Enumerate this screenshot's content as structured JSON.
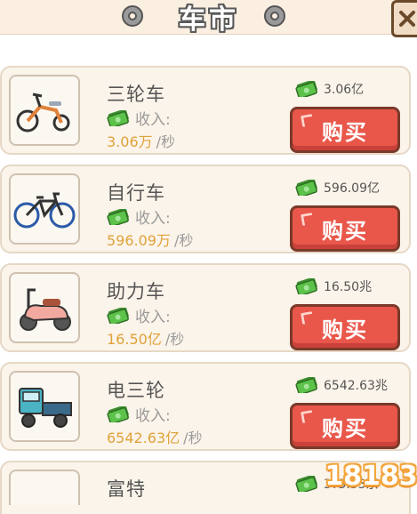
{
  "header": {
    "title": "车市"
  },
  "labels": {
    "income": "收入:",
    "per_second": "/秒",
    "buy": "购买"
  },
  "vehicles": [
    {
      "name": "三轮车",
      "rate": "3.06万",
      "price": "3.06亿",
      "icon": "tricycle-icon"
    },
    {
      "name": "自行车",
      "rate": "596.09万",
      "price": "596.09亿",
      "icon": "bicycle-icon"
    },
    {
      "name": "助力车",
      "rate": "16.50亿",
      "price": "16.50兆",
      "icon": "scooter-icon"
    },
    {
      "name": "电三轮",
      "rate": "6542.63亿",
      "price": "6542.63兆",
      "icon": "electric-tricycle-icon"
    },
    {
      "name": "富特",
      "price": "3?3.33京"
    }
  ],
  "watermark": "18183",
  "colors": {
    "buy_button": "#e9574b",
    "rate_text": "#e0a23a",
    "card_bg": "#fbf4ea",
    "header_bg": "#fbefe2"
  }
}
